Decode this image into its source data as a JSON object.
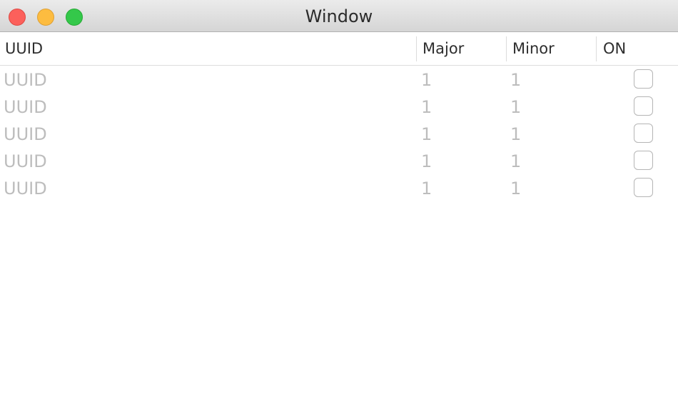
{
  "window": {
    "title": "Window"
  },
  "table": {
    "columns": [
      {
        "label": "UUID"
      },
      {
        "label": "Major"
      },
      {
        "label": "Minor"
      },
      {
        "label": "ON"
      }
    ],
    "rows": [
      {
        "uuid": "UUID",
        "major": "1",
        "minor": "1",
        "on": false
      },
      {
        "uuid": "UUID",
        "major": "1",
        "minor": "1",
        "on": false
      },
      {
        "uuid": "UUID",
        "major": "1",
        "minor": "1",
        "on": false
      },
      {
        "uuid": "UUID",
        "major": "1",
        "minor": "1",
        "on": false
      },
      {
        "uuid": "UUID",
        "major": "1",
        "minor": "1",
        "on": false
      }
    ]
  },
  "colors": {
    "close": "#fc605b",
    "minimize": "#fdbc40",
    "maximize": "#34c84a",
    "placeholder_text": "#bdbdbd"
  }
}
